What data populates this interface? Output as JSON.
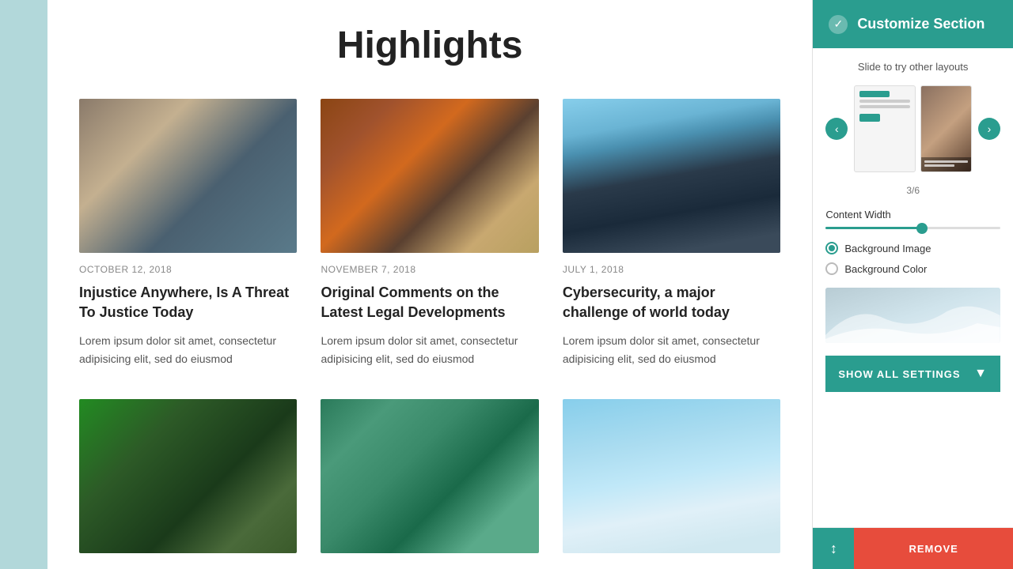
{
  "page": {
    "title": "Highlights"
  },
  "articles": [
    {
      "date": "OCTOBER 12, 2018",
      "title": "Injustice Anywhere, Is A Threat To Justice Today",
      "excerpt": "Lorem ipsum dolor sit amet, consectetur adipisicing elit, sed do eiusmod",
      "img_class": "img-meeting"
    },
    {
      "date": "NOVEMBER 7, 2018",
      "title": "Original Comments on the Latest Legal Developments",
      "excerpt": "Lorem ipsum dolor sit amet, consectetur adipisicing elit, sed do eiusmod",
      "img_class": "img-gavel"
    },
    {
      "date": "JULY 1, 2018",
      "title": "Cybersecurity, a major challenge of world today",
      "excerpt": "Lorem ipsum dolor sit amet, consectetur adipisicing elit, sed do eiusmod",
      "img_class": "img-buildings"
    }
  ],
  "articles_row2": [
    {
      "img_class": "img-outdoor"
    },
    {
      "img_class": "img-colorful"
    },
    {
      "img_class": "img-satellite"
    }
  ],
  "sidebar": {
    "header_title": "Customize Section",
    "slide_hint": "Slide to try other layouts",
    "carousel_count": "3/6",
    "content_width_label": "Content Width",
    "bg_image_label": "Background Image",
    "bg_color_label": "Background Color",
    "show_all_label": "SHOW ALL SETTINGS",
    "remove_label": "REMOVE"
  }
}
